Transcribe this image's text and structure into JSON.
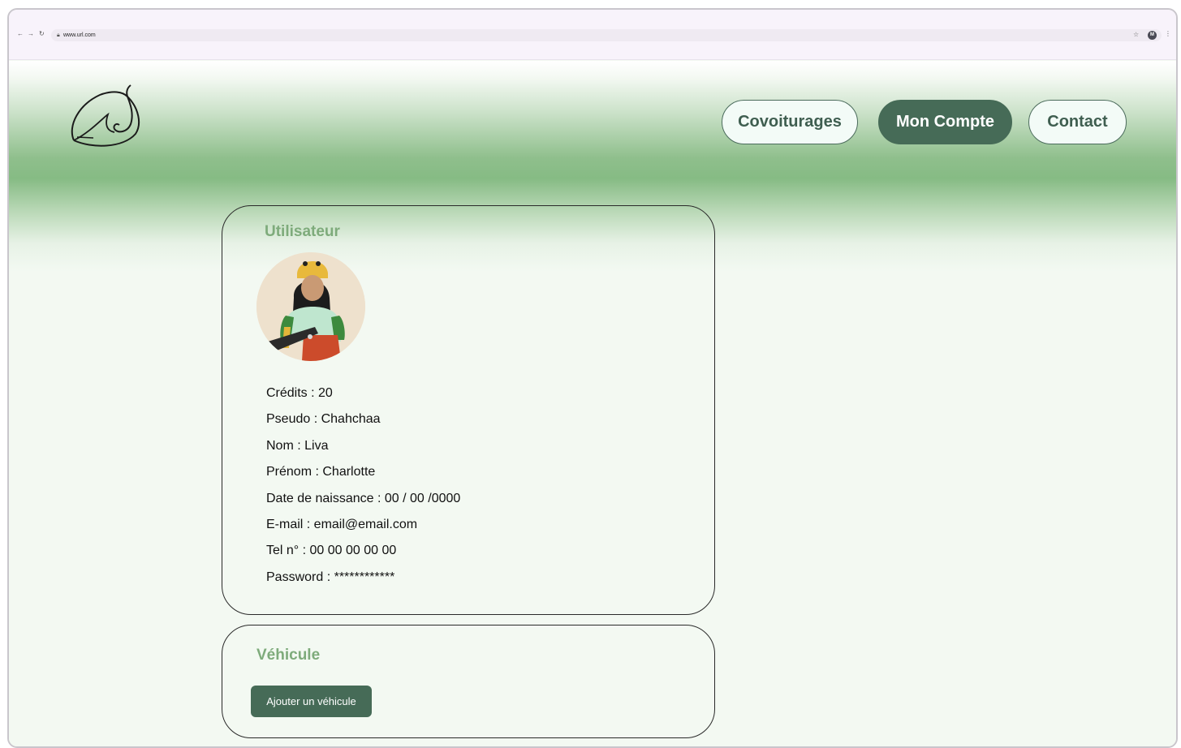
{
  "browser": {
    "url": "www.url.com",
    "profile_initial": "M"
  },
  "header": {
    "nav": [
      {
        "label": "Covoiturages",
        "active": false
      },
      {
        "label": "Mon Compte",
        "active": true
      },
      {
        "label": "Contact",
        "active": false
      }
    ]
  },
  "user_card": {
    "title": "Utilisateur",
    "fields": [
      "Crédits : 20",
      "Pseudo : Chahchaa",
      "Nom : Liva",
      "Prénom : Charlotte",
      "Date de naissance : 00 / 00 /0000",
      "E-mail : email@email.com",
      "Tel n° : 00 00 00 00 00",
      "Password : ************"
    ]
  },
  "vehicle_card": {
    "title": "Véhicule",
    "add_button_label": "Ajouter un véhicule"
  },
  "colors": {
    "accent": "#466b57",
    "title_green": "#7eab7b",
    "band_green": "#86bb84"
  }
}
